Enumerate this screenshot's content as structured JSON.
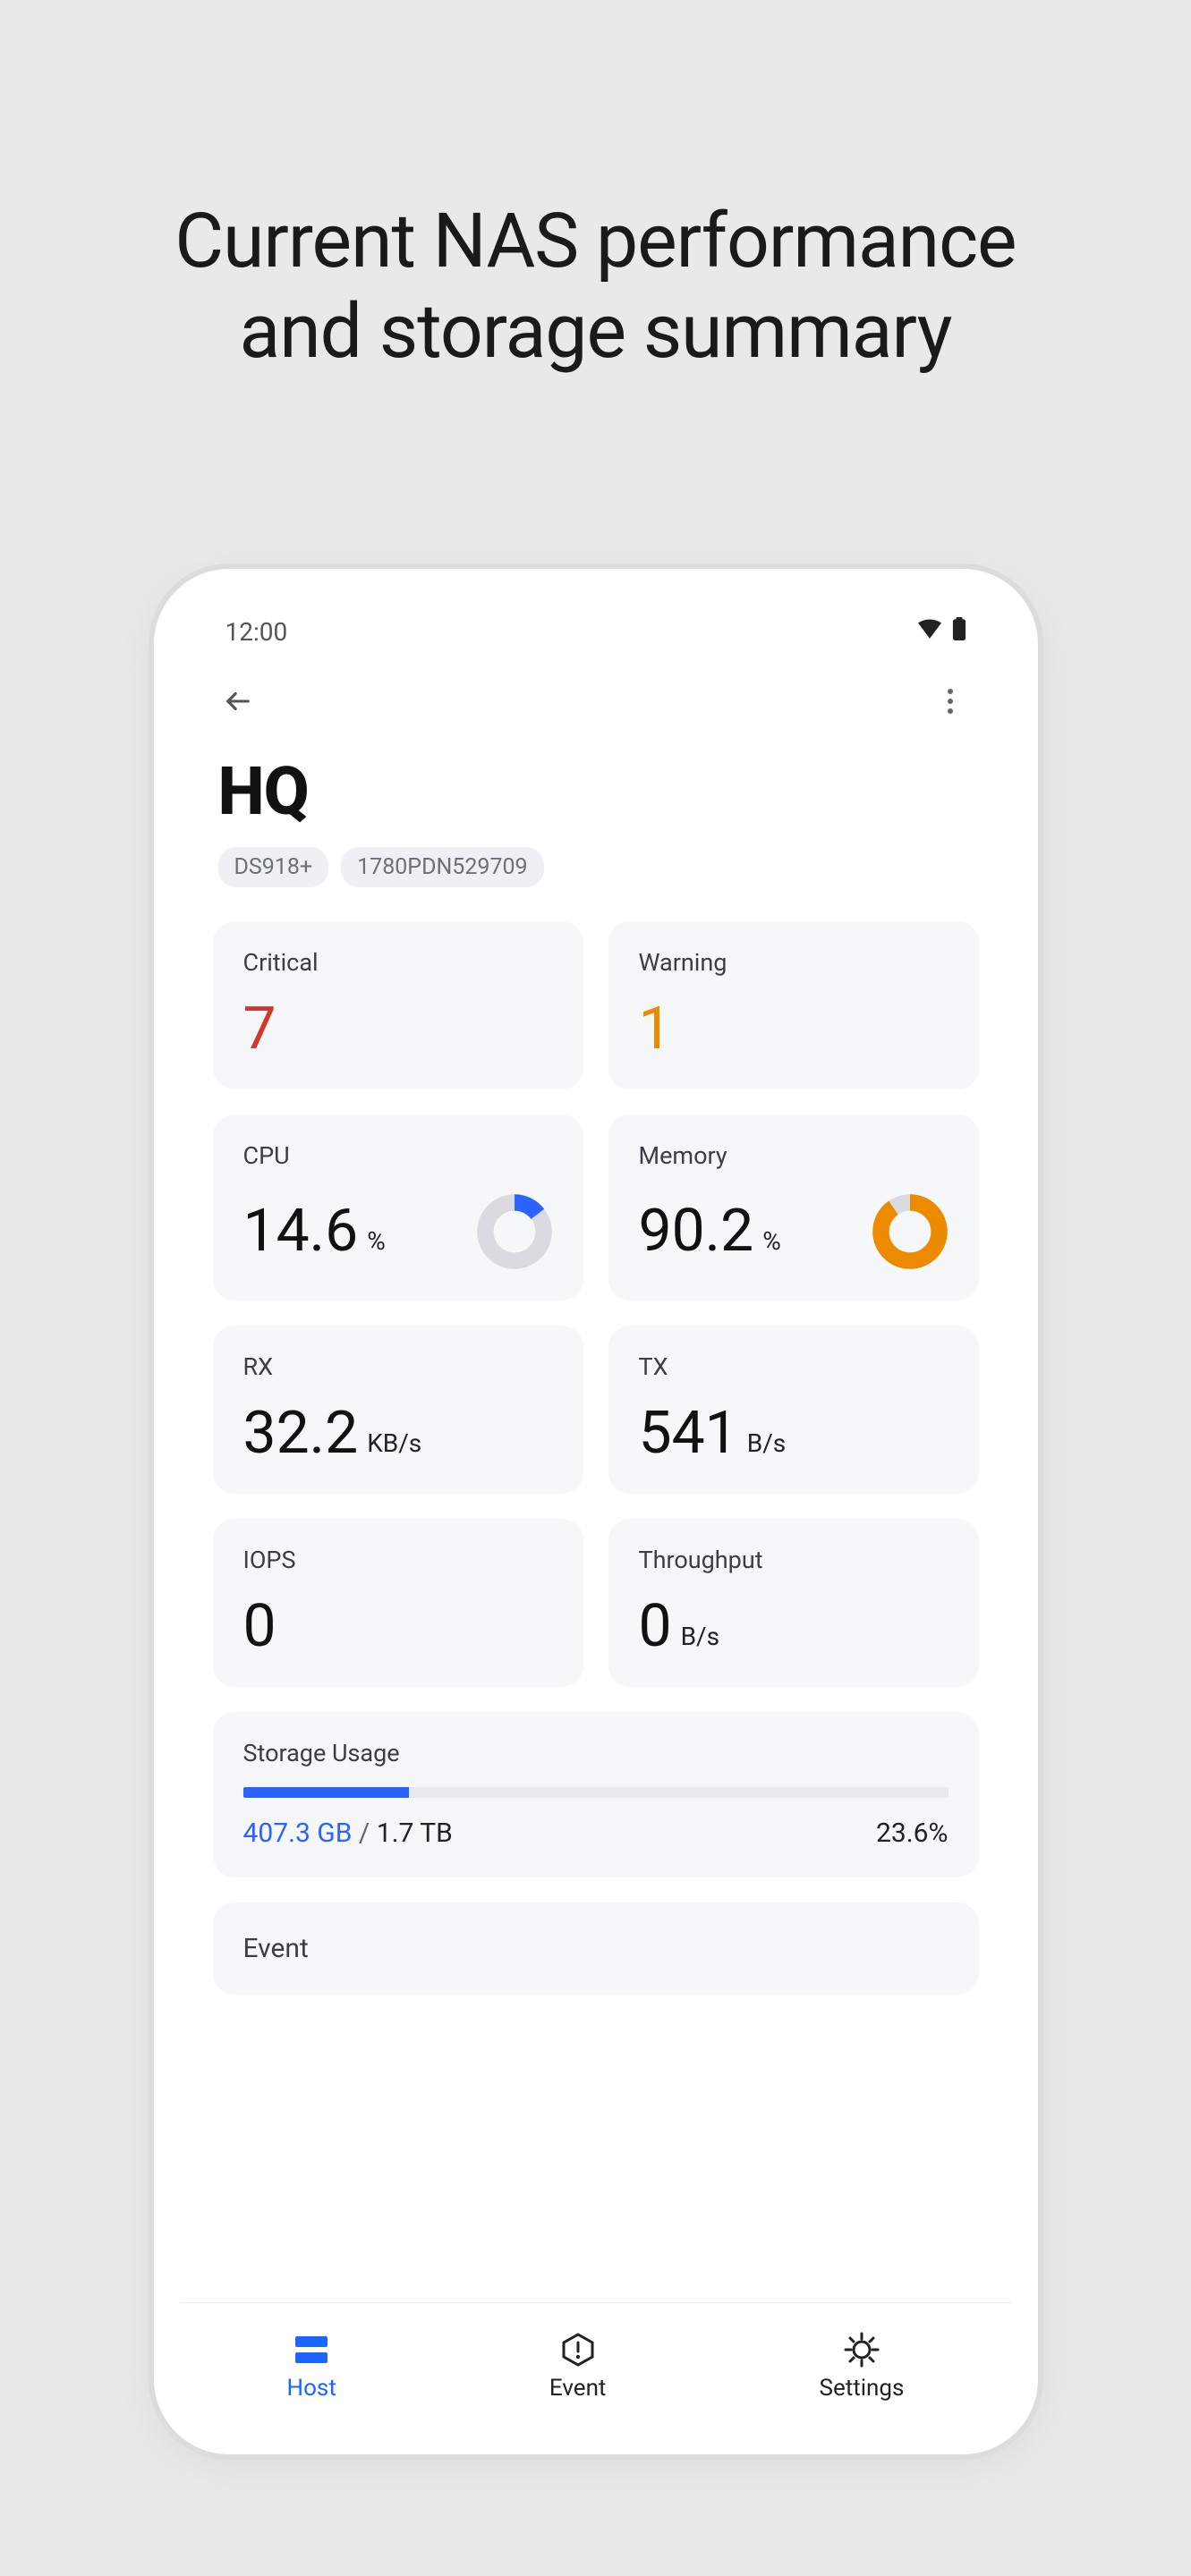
{
  "marketing": {
    "line1": "Current NAS performance",
    "line2": "and storage summary"
  },
  "status_bar": {
    "time": "12:00"
  },
  "header": {
    "title": "HQ",
    "chips": [
      "DS918+",
      "1780PDN529709"
    ]
  },
  "alerts": {
    "critical": {
      "label": "Critical",
      "value": "7"
    },
    "warning": {
      "label": "Warning",
      "value": "1"
    }
  },
  "metrics": {
    "cpu": {
      "label": "CPU",
      "value": "14.6",
      "unit": "%",
      "percent": 14.6,
      "color": "#2a63ff"
    },
    "memory": {
      "label": "Memory",
      "value": "90.2",
      "unit": "%",
      "percent": 90.2,
      "color": "#ed8b00"
    },
    "rx": {
      "label": "RX",
      "value": "32.2",
      "unit": "KB/s"
    },
    "tx": {
      "label": "TX",
      "value": "541",
      "unit": "B/s"
    },
    "iops": {
      "label": "IOPS",
      "value": "0",
      "unit": ""
    },
    "throughput": {
      "label": "Throughput",
      "value": "0",
      "unit": "B/s"
    }
  },
  "storage": {
    "label": "Storage Usage",
    "used": "407.3 GB",
    "total": "1.7 TB",
    "percent_text": "23.6%",
    "percent": 23.6
  },
  "event_section": {
    "label": "Event"
  },
  "nav": {
    "host": {
      "label": "Host"
    },
    "event": {
      "label": "Event"
    },
    "settings": {
      "label": "Settings"
    }
  }
}
